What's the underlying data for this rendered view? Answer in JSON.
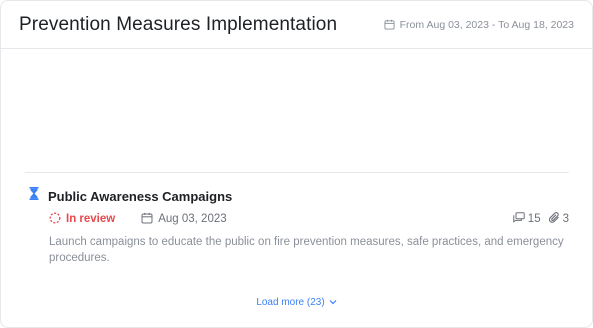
{
  "header": {
    "title": "Prevention Measures Implementation",
    "date_range": "From Aug 03, 2023 - To Aug 18, 2023"
  },
  "item": {
    "title": "Public Awareness Campaigns",
    "status": "In review",
    "date": "Aug 03, 2023",
    "comments": "15",
    "attachments": "3",
    "description": "Launch campaigns to educate the public on fire prevention measures, safe practices, and emergency procedures."
  },
  "footer": {
    "load_more": "Load more (23)"
  },
  "colors": {
    "status": "#e5484d",
    "accent": "#3b82f6",
    "hourglass": "#3b82f6"
  },
  "icons": [
    "calendar-icon",
    "hourglass-icon",
    "status-dashed-circle-icon",
    "comment-icon",
    "paperclip-icon",
    "chevron-down-icon"
  ]
}
